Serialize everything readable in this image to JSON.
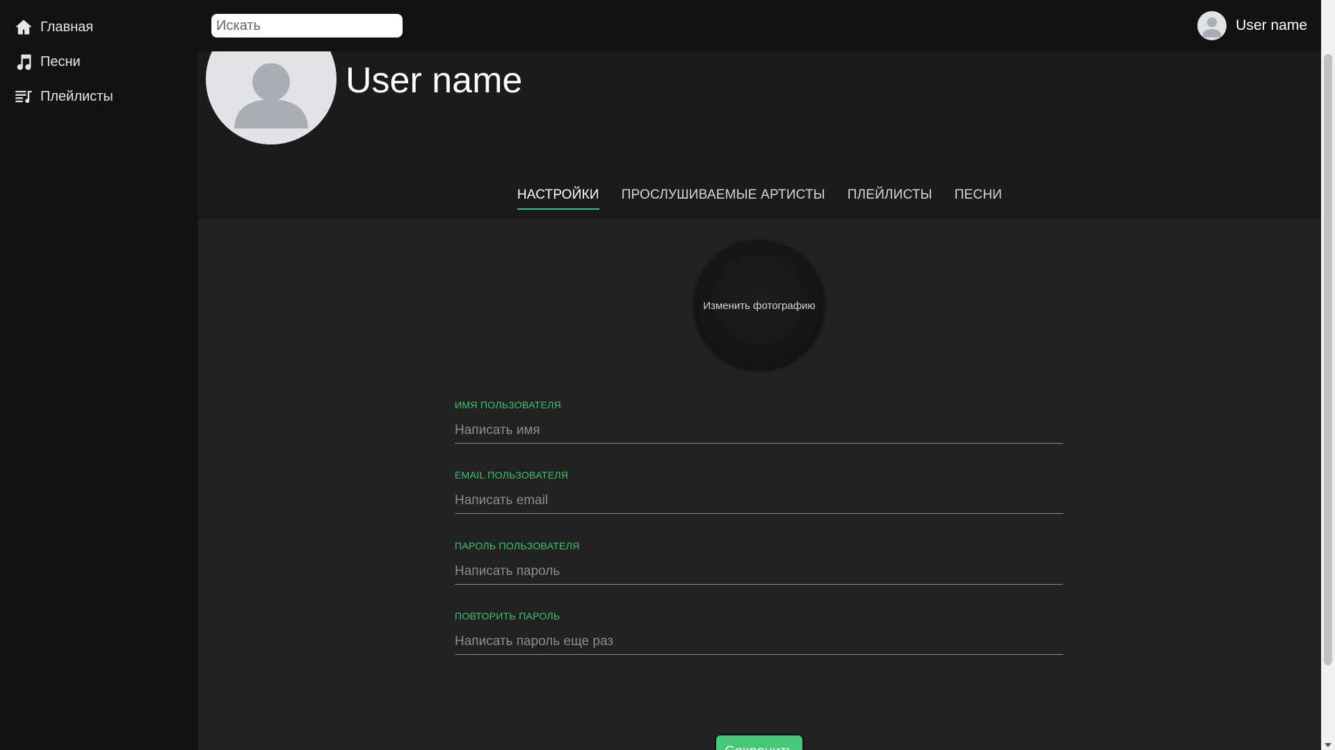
{
  "sidebar": {
    "items": [
      {
        "label": "Главная",
        "icon": "home-icon"
      },
      {
        "label": "Песни",
        "icon": "music-note-icon"
      },
      {
        "label": "Плейлисты",
        "icon": "playlist-icon"
      }
    ]
  },
  "header": {
    "search_placeholder": "Искать",
    "user_name": "User name"
  },
  "profile": {
    "name": "User name",
    "tabs": [
      {
        "label": "НАСТРОЙКИ",
        "active": true
      },
      {
        "label": "ПРОСЛУШИВАЕМЫЕ АРТИСТЫ",
        "active": false
      },
      {
        "label": "ПЛЕЙЛИСТЫ",
        "active": false
      },
      {
        "label": "ПЕСНИ",
        "active": false
      }
    ]
  },
  "settings": {
    "change_photo_label": "Изменить фотографию",
    "fields": [
      {
        "label": "ИМЯ ПОЛЬЗОВАТЕЛЯ",
        "placeholder": "Написать имя",
        "value": ""
      },
      {
        "label": "EMAIL ПОЛЬЗОВАТЕЛЯ",
        "placeholder": "Написать email",
        "value": ""
      },
      {
        "label": "ПАРОЛЬ ПОЛЬЗОВАТЕЛЯ",
        "placeholder": "Написать пароль",
        "value": ""
      },
      {
        "label": "ПОВТОРИТЬ ПАРОЛЬ",
        "placeholder": "Написать пароль еще раз",
        "value": ""
      }
    ],
    "save_label": "Сохранить"
  },
  "colors": {
    "accent": "#39c671",
    "button": "#45c879",
    "background": "#222222",
    "sidebar": "#121212"
  }
}
